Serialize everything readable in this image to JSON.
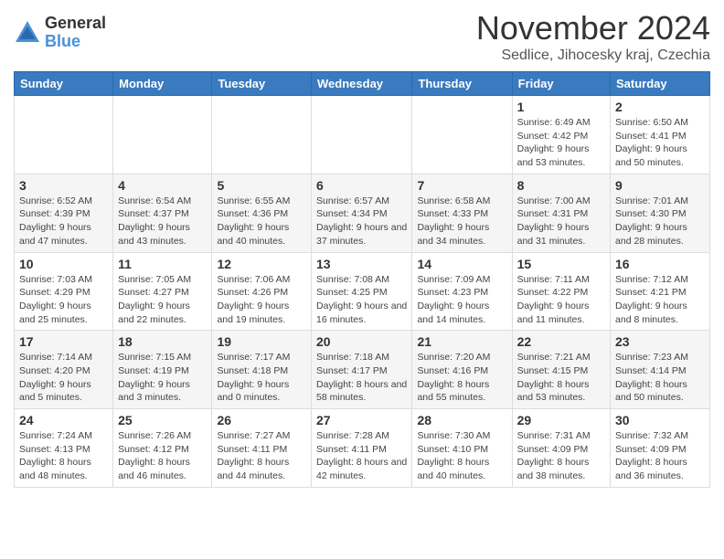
{
  "logo": {
    "general": "General",
    "blue": "Blue"
  },
  "title": "November 2024",
  "location": "Sedlice, Jihocesky kraj, Czechia",
  "headers": [
    "Sunday",
    "Monday",
    "Tuesday",
    "Wednesday",
    "Thursday",
    "Friday",
    "Saturday"
  ],
  "weeks": [
    [
      {
        "day": "",
        "info": ""
      },
      {
        "day": "",
        "info": ""
      },
      {
        "day": "",
        "info": ""
      },
      {
        "day": "",
        "info": ""
      },
      {
        "day": "",
        "info": ""
      },
      {
        "day": "1",
        "info": "Sunrise: 6:49 AM\nSunset: 4:42 PM\nDaylight: 9 hours and 53 minutes."
      },
      {
        "day": "2",
        "info": "Sunrise: 6:50 AM\nSunset: 4:41 PM\nDaylight: 9 hours and 50 minutes."
      }
    ],
    [
      {
        "day": "3",
        "info": "Sunrise: 6:52 AM\nSunset: 4:39 PM\nDaylight: 9 hours and 47 minutes."
      },
      {
        "day": "4",
        "info": "Sunrise: 6:54 AM\nSunset: 4:37 PM\nDaylight: 9 hours and 43 minutes."
      },
      {
        "day": "5",
        "info": "Sunrise: 6:55 AM\nSunset: 4:36 PM\nDaylight: 9 hours and 40 minutes."
      },
      {
        "day": "6",
        "info": "Sunrise: 6:57 AM\nSunset: 4:34 PM\nDaylight: 9 hours and 37 minutes."
      },
      {
        "day": "7",
        "info": "Sunrise: 6:58 AM\nSunset: 4:33 PM\nDaylight: 9 hours and 34 minutes."
      },
      {
        "day": "8",
        "info": "Sunrise: 7:00 AM\nSunset: 4:31 PM\nDaylight: 9 hours and 31 minutes."
      },
      {
        "day": "9",
        "info": "Sunrise: 7:01 AM\nSunset: 4:30 PM\nDaylight: 9 hours and 28 minutes."
      }
    ],
    [
      {
        "day": "10",
        "info": "Sunrise: 7:03 AM\nSunset: 4:29 PM\nDaylight: 9 hours and 25 minutes."
      },
      {
        "day": "11",
        "info": "Sunrise: 7:05 AM\nSunset: 4:27 PM\nDaylight: 9 hours and 22 minutes."
      },
      {
        "day": "12",
        "info": "Sunrise: 7:06 AM\nSunset: 4:26 PM\nDaylight: 9 hours and 19 minutes."
      },
      {
        "day": "13",
        "info": "Sunrise: 7:08 AM\nSunset: 4:25 PM\nDaylight: 9 hours and 16 minutes."
      },
      {
        "day": "14",
        "info": "Sunrise: 7:09 AM\nSunset: 4:23 PM\nDaylight: 9 hours and 14 minutes."
      },
      {
        "day": "15",
        "info": "Sunrise: 7:11 AM\nSunset: 4:22 PM\nDaylight: 9 hours and 11 minutes."
      },
      {
        "day": "16",
        "info": "Sunrise: 7:12 AM\nSunset: 4:21 PM\nDaylight: 9 hours and 8 minutes."
      }
    ],
    [
      {
        "day": "17",
        "info": "Sunrise: 7:14 AM\nSunset: 4:20 PM\nDaylight: 9 hours and 5 minutes."
      },
      {
        "day": "18",
        "info": "Sunrise: 7:15 AM\nSunset: 4:19 PM\nDaylight: 9 hours and 3 minutes."
      },
      {
        "day": "19",
        "info": "Sunrise: 7:17 AM\nSunset: 4:18 PM\nDaylight: 9 hours and 0 minutes."
      },
      {
        "day": "20",
        "info": "Sunrise: 7:18 AM\nSunset: 4:17 PM\nDaylight: 8 hours and 58 minutes."
      },
      {
        "day": "21",
        "info": "Sunrise: 7:20 AM\nSunset: 4:16 PM\nDaylight: 8 hours and 55 minutes."
      },
      {
        "day": "22",
        "info": "Sunrise: 7:21 AM\nSunset: 4:15 PM\nDaylight: 8 hours and 53 minutes."
      },
      {
        "day": "23",
        "info": "Sunrise: 7:23 AM\nSunset: 4:14 PM\nDaylight: 8 hours and 50 minutes."
      }
    ],
    [
      {
        "day": "24",
        "info": "Sunrise: 7:24 AM\nSunset: 4:13 PM\nDaylight: 8 hours and 48 minutes."
      },
      {
        "day": "25",
        "info": "Sunrise: 7:26 AM\nSunset: 4:12 PM\nDaylight: 8 hours and 46 minutes."
      },
      {
        "day": "26",
        "info": "Sunrise: 7:27 AM\nSunset: 4:11 PM\nDaylight: 8 hours and 44 minutes."
      },
      {
        "day": "27",
        "info": "Sunrise: 7:28 AM\nSunset: 4:11 PM\nDaylight: 8 hours and 42 minutes."
      },
      {
        "day": "28",
        "info": "Sunrise: 7:30 AM\nSunset: 4:10 PM\nDaylight: 8 hours and 40 minutes."
      },
      {
        "day": "29",
        "info": "Sunrise: 7:31 AM\nSunset: 4:09 PM\nDaylight: 8 hours and 38 minutes."
      },
      {
        "day": "30",
        "info": "Sunrise: 7:32 AM\nSunset: 4:09 PM\nDaylight: 8 hours and 36 minutes."
      }
    ]
  ]
}
